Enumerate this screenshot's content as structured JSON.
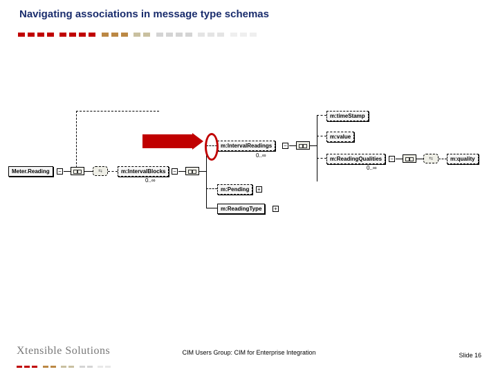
{
  "title": "Navigating associations in message type schemas",
  "company": "Xtensible Solutions",
  "footer": "CIM Users Group: CIM for Enterprise Integration",
  "slide_label": "Slide",
  "slide_number": "16",
  "nodes": {
    "root": "Meter.Reading",
    "intervalBlocks": "m:IntervalBlocks",
    "intervalReadings": "m:IntervalReadings",
    "pending": "m:Pending",
    "readingType": "m:ReadingType",
    "timeStamp": "m:timeStamp",
    "value": "m:value",
    "readingQualities": "m:ReadingQualities",
    "quality": "m:quality"
  },
  "mult": {
    "ib": "0..∞",
    "ir": "0..∞",
    "rq": "0..∞"
  },
  "expand": {
    "minus": "−",
    "plus": "+"
  }
}
